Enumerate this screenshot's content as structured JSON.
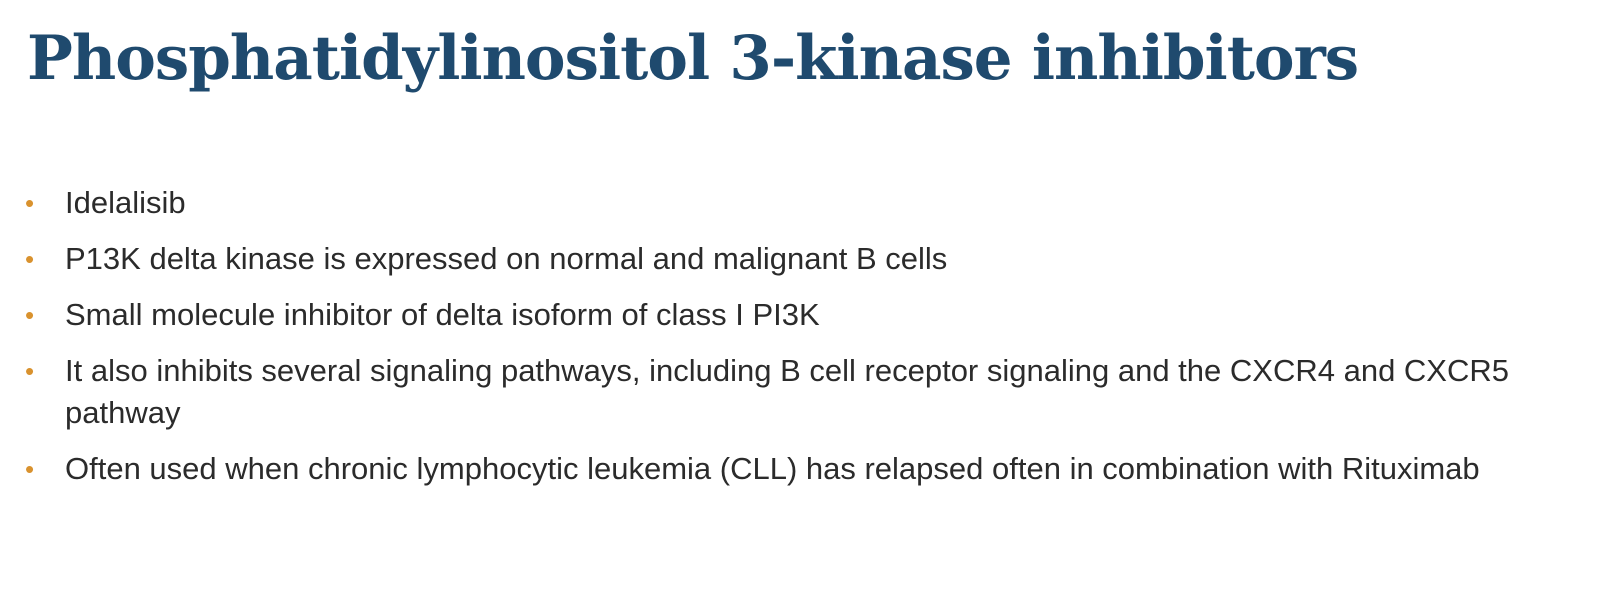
{
  "slide": {
    "title": "Phosphatidylinositol 3-kinase inhibitors",
    "bullet_color": "#d9922e",
    "title_color": "#1f4a6e",
    "bullets": [
      {
        "marker": "•",
        "text": "Idelalisib"
      },
      {
        "marker": "•",
        "text": "P13K delta kinase is expressed on normal and malignant B cells"
      },
      {
        "marker": "•",
        "text": "Small molecule inhibitor of delta isoform of class I PI3K"
      },
      {
        "marker": "•",
        "text": "It also inhibits several signaling pathways, including B cell receptor signaling and the CXCR4 and CXCR5 pathway"
      },
      {
        "marker": "•",
        "text": "Often used when chronic lymphocytic leukemia (CLL) has relapsed often in combination with Rituximab"
      }
    ]
  }
}
